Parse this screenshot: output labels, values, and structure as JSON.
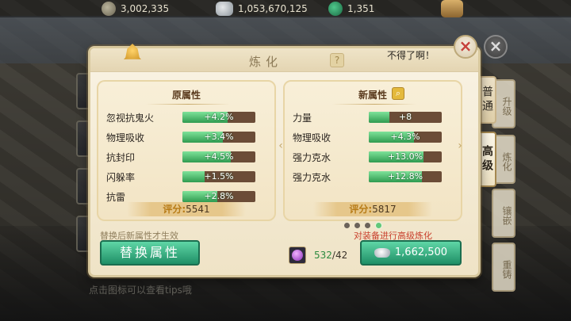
{
  "currencies": [
    {
      "name": "coin-icon",
      "value": "3,002,335"
    },
    {
      "name": "silver-icon",
      "value": "1,053,670,125"
    },
    {
      "name": "jade-icon",
      "value": "1,351"
    }
  ],
  "background": {
    "tabs": [
      "升级",
      "炼化",
      "镶嵌",
      "重铸"
    ],
    "hint": "点击图标可以查看tips哦"
  },
  "dialog": {
    "title": "炼化",
    "help_label": "?",
    "tooltip": "不得了啊！",
    "close_label": "×",
    "tabs": {
      "normal": "普通",
      "advanced": "高级"
    },
    "original": {
      "title": "原属性",
      "attributes": [
        {
          "name": "忽视抗鬼火",
          "value": "+4.2%",
          "fill": 0.62
        },
        {
          "name": "物理吸收",
          "value": "+3.4%",
          "fill": 0.55
        },
        {
          "name": "抗封印",
          "value": "+4.5%",
          "fill": 0.66
        },
        {
          "name": "闪躲率",
          "value": "+1.5%",
          "fill": 0.3
        },
        {
          "name": "抗雷",
          "value": "+2.8%",
          "fill": 0.48
        }
      ],
      "score_label": "评分:",
      "score": "5541"
    },
    "new": {
      "title": "新属性",
      "attributes": [
        {
          "name": "力量",
          "value": "+8",
          "fill": 0.28
        },
        {
          "name": "物理吸收",
          "value": "+4.3%",
          "fill": 0.62
        },
        {
          "name": "强力克水",
          "value": "+13.0%",
          "fill": 0.75
        },
        {
          "name": "强力克水",
          "value": "+12.8%",
          "fill": 0.73
        }
      ],
      "score_label": "评分:",
      "score": "5817"
    },
    "arrows": {
      "left": "‹",
      "right": "›"
    },
    "hint_left": "替换后新属性才生效",
    "hint_right": "对装备进行高级炼化",
    "replace_button": "替换属性",
    "orb_owned": "532",
    "orb_required": "/42",
    "refine_cost": "1,662,500",
    "colors": {
      "accent_green": "#2f9b50",
      "warning_red": "#c9402d",
      "score_gold": "#b77b16"
    }
  }
}
